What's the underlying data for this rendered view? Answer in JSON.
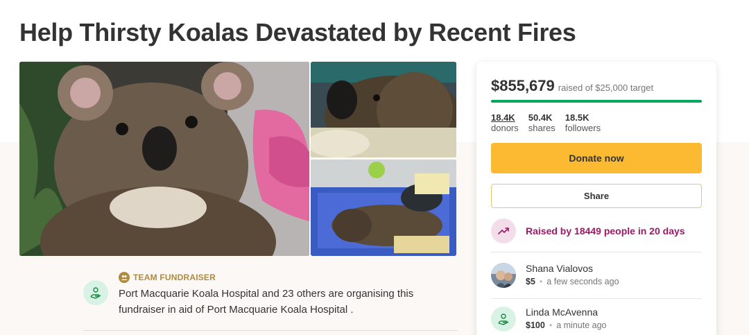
{
  "campaign": {
    "title": "Help Thirsty Koalas Devastated by Recent Fires"
  },
  "organizer": {
    "badge": "TEAM FUNDRAISER",
    "description": "Port Macquarie Koala Hospital and 23 others are organising this fundraiser in aid of Port Macquarie Koala Hospital ."
  },
  "donation": {
    "amount": "$855,679",
    "raised_of": "raised of $25,000 target",
    "progress_percent": 100,
    "progress_color": "#02a95c",
    "stats": [
      {
        "value": "18.4K",
        "label": "donors"
      },
      {
        "value": "50.4K",
        "label": "shares"
      },
      {
        "value": "18.5K",
        "label": "followers"
      }
    ],
    "donate_label": "Donate now",
    "share_label": "Share",
    "trend_text": "Raised by 18449 people in 20 days",
    "accent_colors": {
      "donate": "#fbba31",
      "trend": "#a01767"
    }
  },
  "donors": [
    {
      "name": "Shana Vialovos",
      "amount": "$5",
      "time": "a few seconds ago",
      "avatar": "photo"
    },
    {
      "name": "Linda McAvenna",
      "amount": "$100",
      "time": "a minute ago",
      "avatar": "hand-heart-icon"
    }
  ],
  "icons": {
    "team": "team-badge-icon",
    "organizer": "hand-heart-icon",
    "trend": "trending-up-icon"
  }
}
